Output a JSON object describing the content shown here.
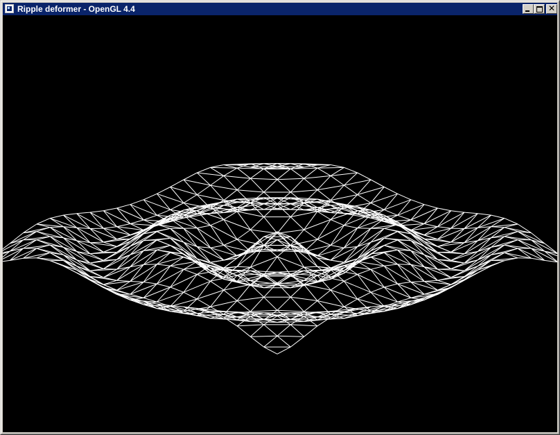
{
  "window": {
    "title": "Ripple deformer - OpenGL 4.4",
    "buttons": {
      "minimize": "minimize-icon",
      "maximize": "maximize-icon",
      "close": "close-icon"
    }
  },
  "viewport": {
    "background": "#000000",
    "mesh_color": "#ffffff",
    "render_mode": "wireframe"
  }
}
